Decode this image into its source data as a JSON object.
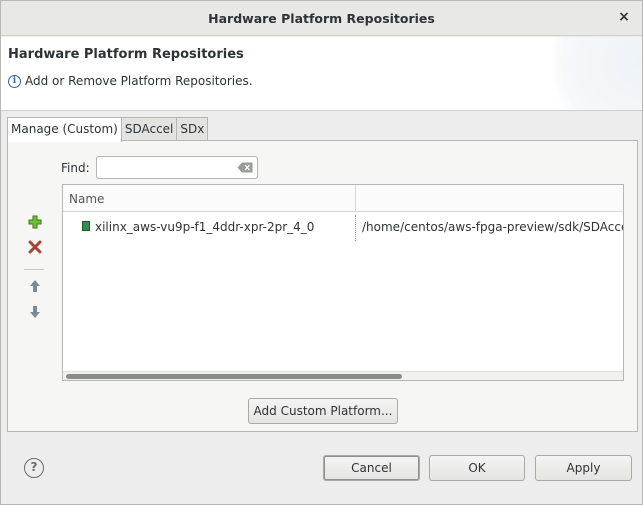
{
  "window": {
    "title": "Hardware Platform Repositories",
    "close_glyph": "×"
  },
  "banner": {
    "heading": "Hardware Platform Repositories",
    "description": "Add or Remove Platform Repositories.",
    "info_glyph": "i"
  },
  "tabs": [
    {
      "label": "Manage (Custom)",
      "active": true
    },
    {
      "label": "SDAccel",
      "active": false
    },
    {
      "label": "SDx",
      "active": false
    }
  ],
  "sidebar": {
    "add_icon": "plus-icon",
    "remove_icon": "remove-x-icon",
    "up_icon": "arrow-up-icon",
    "down_icon": "arrow-down-icon",
    "colors": {
      "add": "#4e9a06",
      "remove": "#a5433b",
      "arrows": "#7a8a9a"
    }
  },
  "find": {
    "label": "Find:",
    "value": "",
    "placeholder": ""
  },
  "table": {
    "columns": [
      "Name",
      ""
    ],
    "rows": [
      {
        "name": "xilinx_aws-vu9p-f1_4ddr-xpr-2pr_4_0",
        "path": "/home/centos/aws-fpga-preview/sdk/SDAccel"
      }
    ]
  },
  "buttons": {
    "add_custom": "Add Custom Platform...",
    "cancel": "Cancel",
    "ok": "OK",
    "apply": "Apply",
    "help": "?"
  }
}
